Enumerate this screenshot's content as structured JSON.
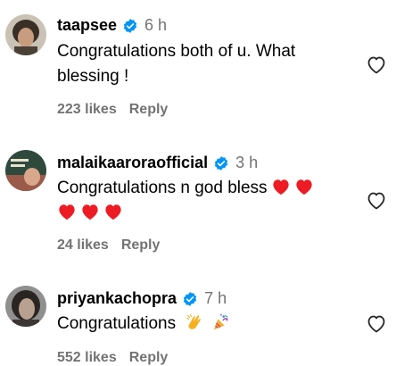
{
  "comments": [
    {
      "username": "taapsee",
      "time": "6 h",
      "text_line1": "Congratulations both of u. What",
      "text_line2": "blessing !",
      "likes": "223 likes",
      "reply": "Reply"
    },
    {
      "username": "malaikaaroraofficial",
      "time": "3 h",
      "text_line1": "Congratulations n god bless",
      "likes": "24 likes",
      "reply": "Reply"
    },
    {
      "username": "priyankachopra",
      "time": "7 h",
      "text_line1": "Congratulations",
      "likes": "552 likes",
      "reply": "Reply"
    }
  ],
  "colors": {
    "verified_blue": "#0095f6",
    "secondary_text": "#737373",
    "heart_red": "#ed1c24"
  },
  "icons": [
    "verified-badge-icon",
    "heart-outline-icon",
    "red-heart-emoji",
    "clapping-hands-emoji",
    "party-popper-emoji"
  ]
}
